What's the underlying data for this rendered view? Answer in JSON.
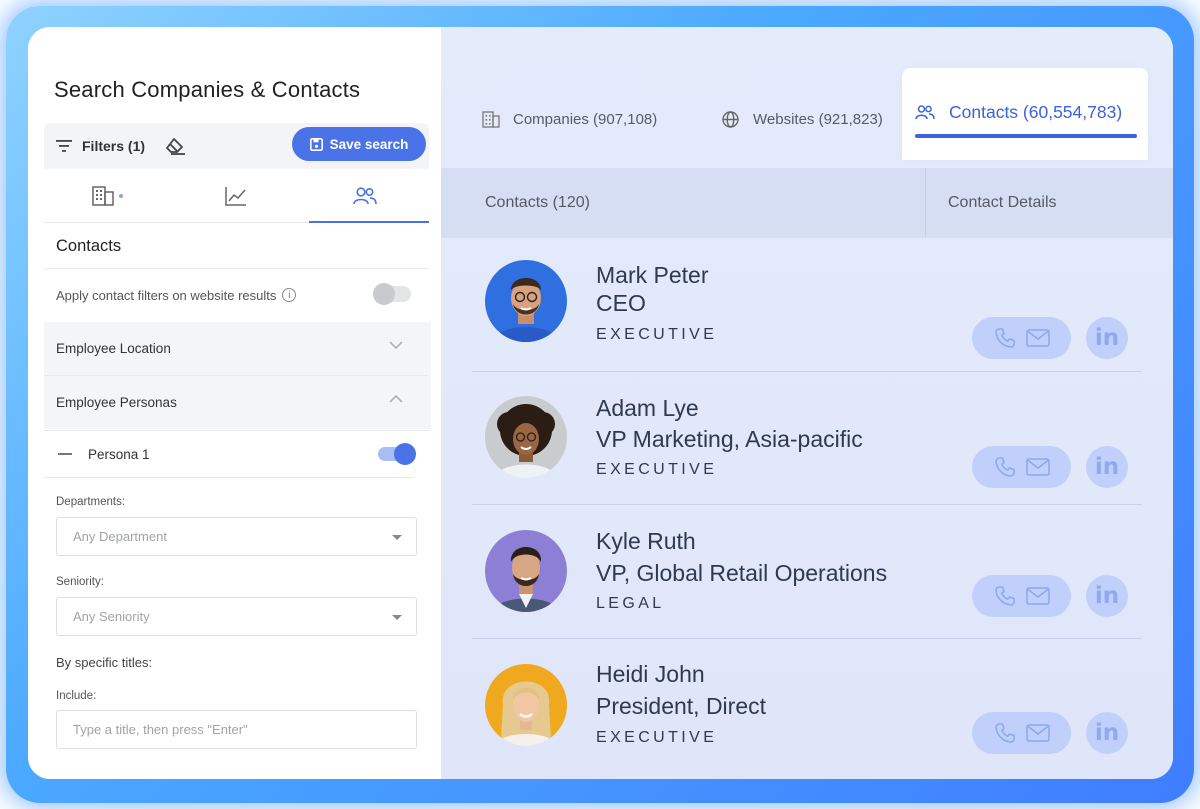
{
  "left_panel": {
    "title": "Search Companies & Contacts",
    "filters_label": "Filters (1)",
    "save_search_label": "Save search",
    "section_title": "Contacts",
    "apply_filters_label": "Apply contact filters on website results",
    "apply_filters_enabled": false,
    "accordions": {
      "employee_location": "Employee Location",
      "employee_personas": "Employee Personas"
    },
    "persona": {
      "label": "Persona 1",
      "enabled": true
    },
    "departments": {
      "label": "Departments:",
      "value": "Any Department"
    },
    "seniority": {
      "label": "Seniority:",
      "value": "Any Seniority"
    },
    "titles": {
      "heading": "By specific titles:",
      "include_label": "Include:",
      "placeholder": "Type a title, then press \"Enter\""
    }
  },
  "tabs": {
    "companies": "Companies (907,108)",
    "websites": "Websites (921,823)",
    "contacts": "Contacts (60,554,783)"
  },
  "table": {
    "col_contacts": "Contacts (120)",
    "col_details": "Contact Details"
  },
  "contacts": [
    {
      "name": "Mark Peter",
      "role": "CEO",
      "level": "EXECUTIVE"
    },
    {
      "name": "Adam Lye",
      "role": "VP Marketing, Asia-pacific",
      "level": "EXECUTIVE"
    },
    {
      "name": "Kyle Ruth",
      "role": "VP, Global Retail Operations",
      "level": "LEGAL"
    },
    {
      "name": "Heidi John",
      "role": "President, Direct",
      "level": "EXECUTIVE"
    }
  ],
  "linkedin_label": "in",
  "colors": {
    "accent": "#4a73e8",
    "active_tab": "#3d63d8",
    "right_bg": "#e2e9fb",
    "pill_bg": "#c0d0fa"
  }
}
